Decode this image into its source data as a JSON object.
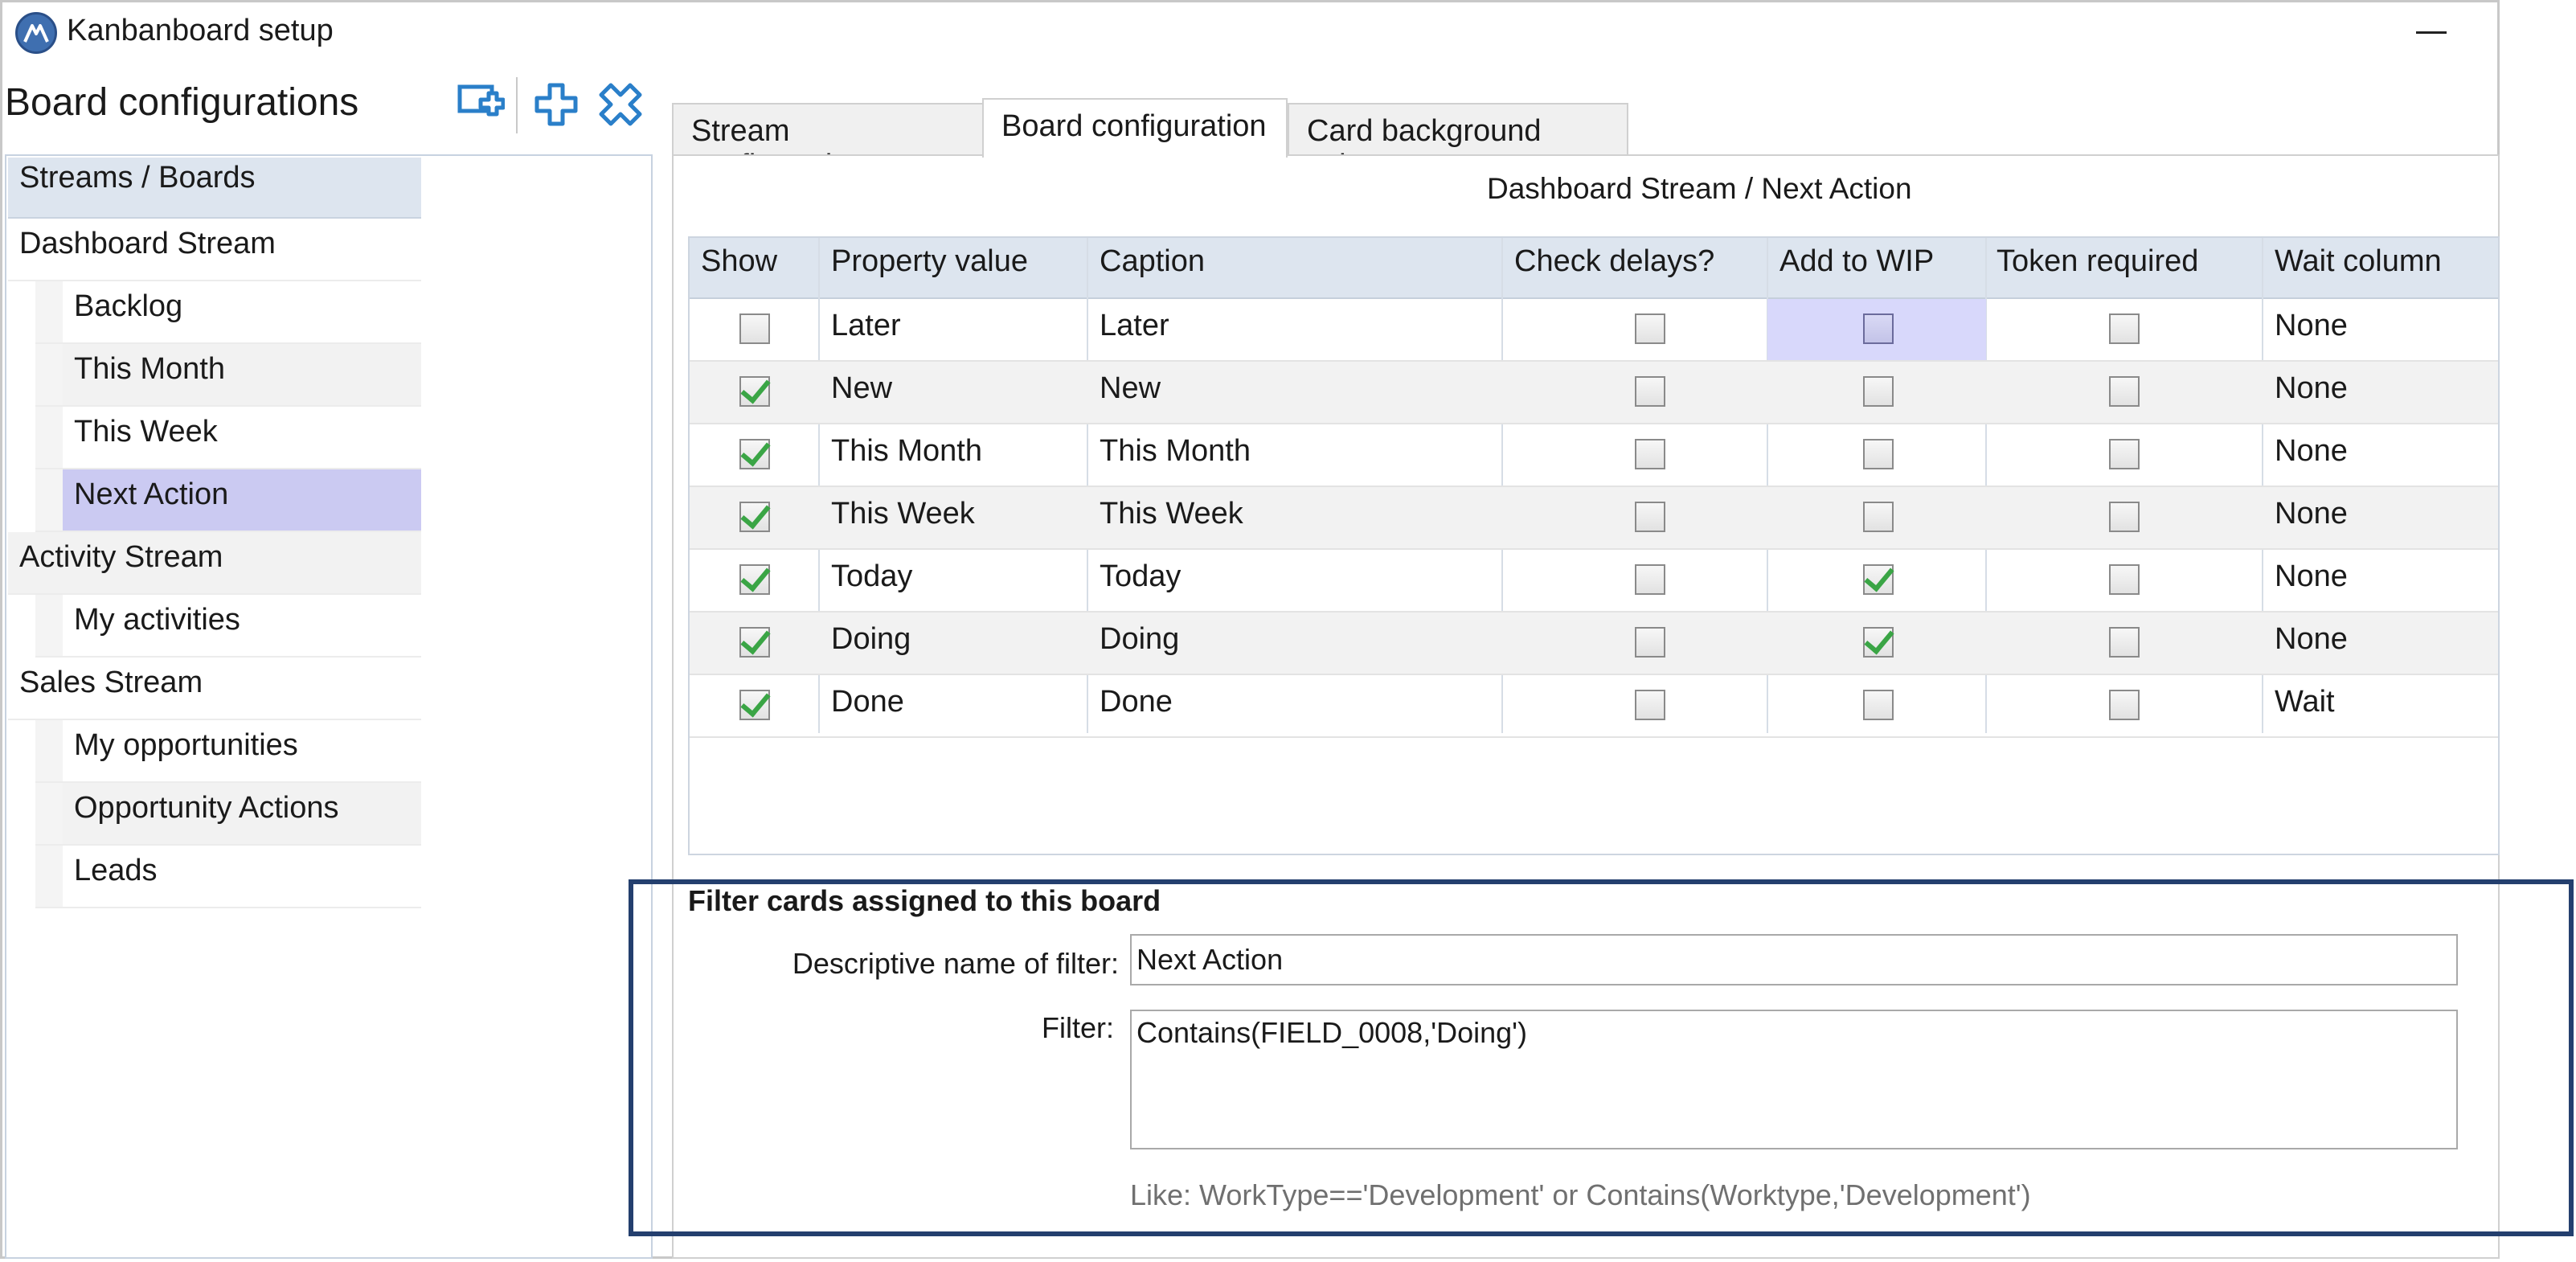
{
  "window": {
    "title": "Kanbanboard setup"
  },
  "left": {
    "header": "Board configurations",
    "toolbar": [
      "add-board-icon",
      "add-icon",
      "delete-icon"
    ],
    "tree_header": "Streams / Boards",
    "tree": [
      {
        "label": "Dashboard Stream",
        "level": 0
      },
      {
        "label": "Backlog",
        "level": 1
      },
      {
        "label": "This Month",
        "level": 1
      },
      {
        "label": "This Week",
        "level": 1
      },
      {
        "label": "Next Action",
        "level": 1,
        "selected": true
      },
      {
        "label": "Activity Stream",
        "level": 0
      },
      {
        "label": "My activities",
        "level": 1
      },
      {
        "label": "Sales Stream",
        "level": 0
      },
      {
        "label": "My opportunities",
        "level": 1
      },
      {
        "label": "Opportunity Actions",
        "level": 1
      },
      {
        "label": "Leads",
        "level": 1
      }
    ]
  },
  "tabs": [
    {
      "label": "Stream configuration",
      "active": false
    },
    {
      "label": "Board configuration",
      "active": true
    },
    {
      "label": "Card background colors",
      "active": false
    }
  ],
  "board_title": "Dashboard Stream / Next Action",
  "grid": {
    "columns": [
      "Show",
      "Property value",
      "Caption",
      "Check delays?",
      "Add to WIP",
      "Token required",
      "Wait column"
    ],
    "rows": [
      {
        "show": false,
        "property": "Later",
        "caption": "Later",
        "check_delays": false,
        "add_to_wip": false,
        "token_required": false,
        "wait_column": "None"
      },
      {
        "show": true,
        "property": "New",
        "caption": "New",
        "check_delays": false,
        "add_to_wip": false,
        "token_required": false,
        "wait_column": "None"
      },
      {
        "show": true,
        "property": "This Month",
        "caption": "This Month",
        "check_delays": false,
        "add_to_wip": false,
        "token_required": false,
        "wait_column": "None"
      },
      {
        "show": true,
        "property": "This Week",
        "caption": "This Week",
        "check_delays": false,
        "add_to_wip": false,
        "token_required": false,
        "wait_column": "None"
      },
      {
        "show": true,
        "property": "Today",
        "caption": "Today",
        "check_delays": false,
        "add_to_wip": true,
        "token_required": false,
        "wait_column": "None"
      },
      {
        "show": true,
        "property": "Doing",
        "caption": "Doing",
        "check_delays": false,
        "add_to_wip": true,
        "token_required": false,
        "wait_column": "None"
      },
      {
        "show": true,
        "property": "Done",
        "caption": "Done",
        "check_delays": false,
        "add_to_wip": false,
        "token_required": false,
        "wait_column": "Wait"
      }
    ]
  },
  "filter": {
    "heading": "Filter cards assigned to this board",
    "name_label": "Descriptive name of filter:",
    "name_value": "Next Action",
    "filter_label": "Filter:",
    "filter_value": "Contains(FIELD_0008,'Doing')",
    "hint": "Like: WorkType=='Development' or Contains(Worktype,'Development')"
  },
  "colors": {
    "accent": "#243f6e",
    "selection": "#cbcaf2",
    "check": "#3aa545",
    "header": "#dde5ef"
  }
}
